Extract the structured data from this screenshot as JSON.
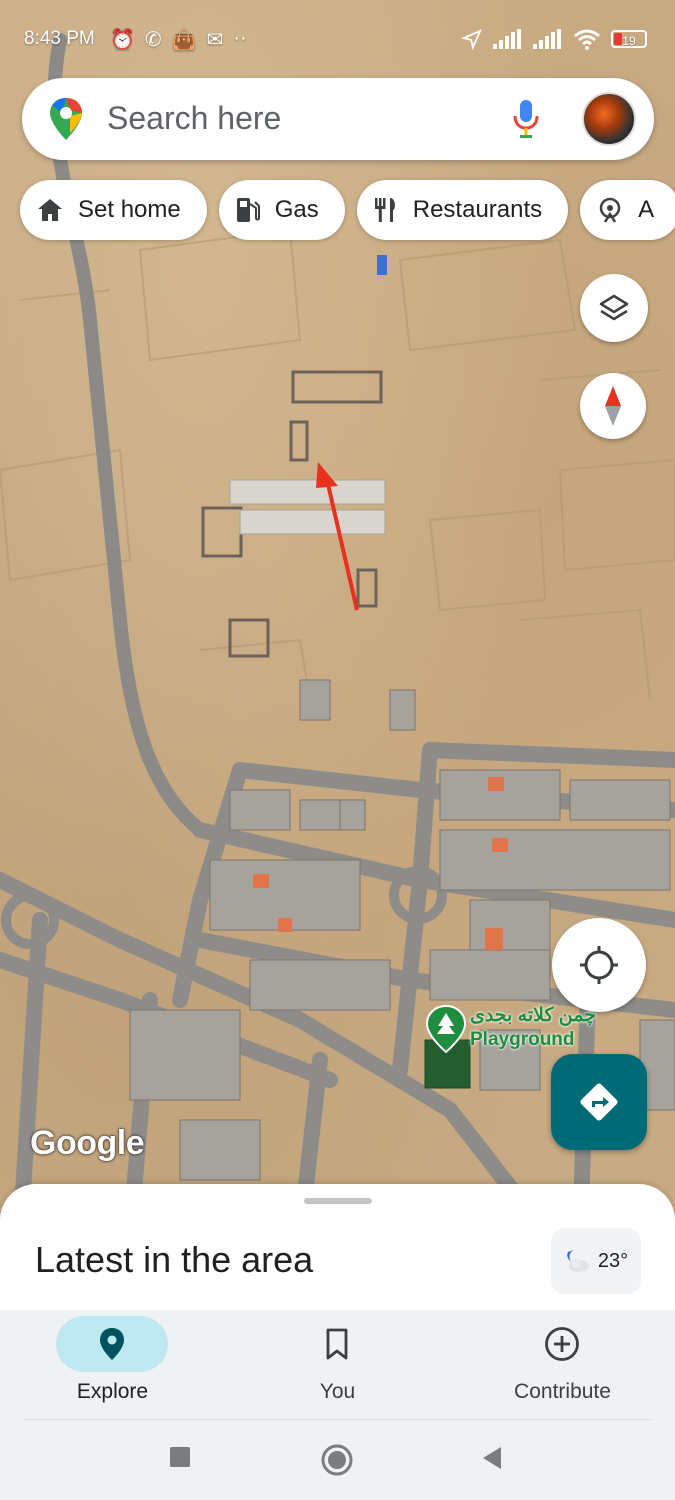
{
  "status_bar": {
    "time": "8:43 PM",
    "battery_level": "19",
    "left_icons": [
      "alarm-icon",
      "whatsapp-icon",
      "shopping-bag-icon",
      "mail-icon",
      "more-dots-icon"
    ],
    "right_icons": [
      "location-arrow-icon",
      "signal-icon",
      "signal-icon",
      "wifi-icon",
      "battery-icon"
    ]
  },
  "search": {
    "placeholder": "Search here",
    "icons": [
      "maps-pin-icon",
      "mic-icon",
      "avatar"
    ]
  },
  "chips": [
    {
      "label": "Set home",
      "icon": "home-icon"
    },
    {
      "label": "Gas",
      "icon": "gas-station-icon"
    },
    {
      "label": "Restaurants",
      "icon": "restaurant-icon"
    },
    {
      "label": "A",
      "icon": "attractions-icon"
    }
  ],
  "map": {
    "attribution": "Google",
    "poi": {
      "name_native": "چمن کلاته بجدی",
      "name_en": "Playground",
      "icon": "tree-icon",
      "color": "#1e8e3e"
    },
    "annotation_arrow_color": "#e8321f"
  },
  "bottom_sheet": {
    "title": "Latest in the area",
    "weather_temp": "23°",
    "weather_icon": "night-cloud-icon"
  },
  "nav": {
    "items": [
      {
        "label": "Explore",
        "icon": "explore-pin-icon",
        "active": true
      },
      {
        "label": "You",
        "icon": "bookmark-icon",
        "active": false
      },
      {
        "label": "Contribute",
        "icon": "add-circle-icon",
        "active": false
      }
    ],
    "active_color": "#bfe9f1",
    "accent": "#006b77"
  },
  "system_nav": [
    "recents-button",
    "home-button",
    "back-button"
  ]
}
